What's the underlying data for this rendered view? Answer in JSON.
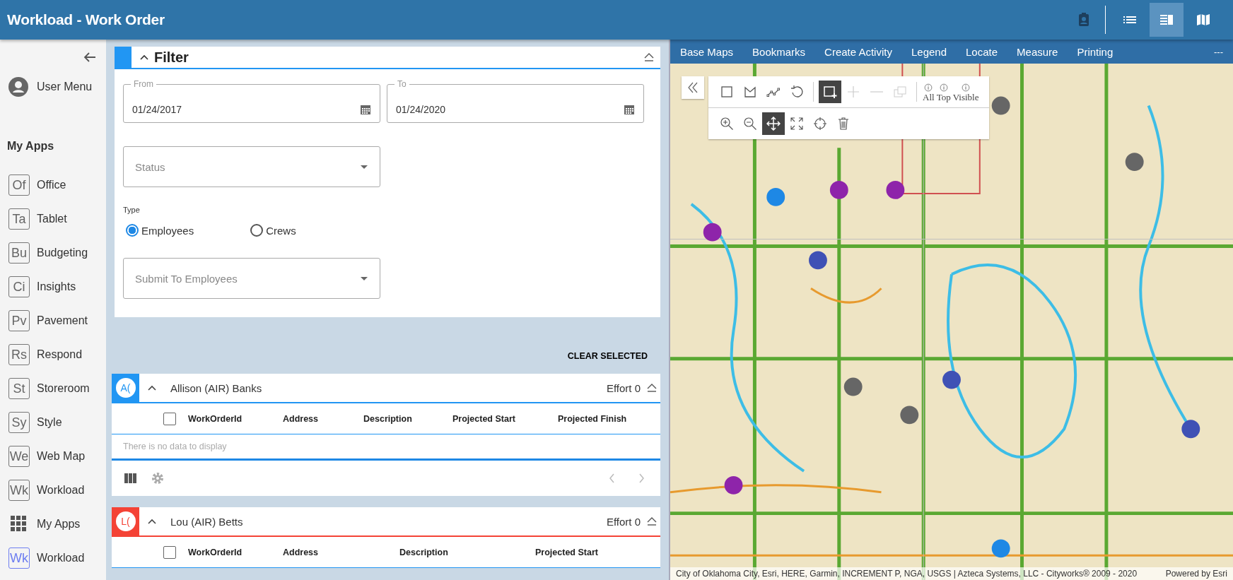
{
  "header": {
    "title": "Workload - Work Order",
    "buttons": [
      {
        "kind": "badge",
        "selected": false
      },
      {
        "kind": "list",
        "selected": false
      },
      {
        "kind": "split",
        "selected": true
      },
      {
        "kind": "map",
        "selected": false
      }
    ]
  },
  "sidebar": {
    "user_menu": "User Menu",
    "section": "My Apps",
    "apps": [
      {
        "kind": "app",
        "abbr": "Of",
        "label": "Office",
        "selected": false
      },
      {
        "kind": "app",
        "abbr": "Ta",
        "label": "Tablet",
        "selected": false
      },
      {
        "kind": "app",
        "abbr": "Bu",
        "label": "Budgeting",
        "selected": false
      },
      {
        "kind": "app",
        "abbr": "Ci",
        "label": "Insights",
        "selected": false
      },
      {
        "kind": "app",
        "abbr": "Pv",
        "label": "Pavement",
        "selected": false
      },
      {
        "kind": "app",
        "abbr": "Rs",
        "label": "Respond",
        "selected": false
      },
      {
        "kind": "app",
        "abbr": "St",
        "label": "Storeroom",
        "selected": false
      },
      {
        "kind": "app",
        "abbr": "Sy",
        "label": "Style",
        "selected": false
      },
      {
        "kind": "app",
        "abbr": "We",
        "label": "Web Map",
        "selected": false
      },
      {
        "kind": "app",
        "abbr": "Wk",
        "label": "Workload",
        "selected": false
      },
      {
        "kind": "grid",
        "label": "My Apps",
        "selected": false
      },
      {
        "kind": "app",
        "abbr": "Wk",
        "label": "Workload",
        "selected": true
      }
    ]
  },
  "filter": {
    "title": "Filter",
    "from": {
      "label": "From",
      "value": "01/24/2017"
    },
    "to": {
      "label": "To",
      "value": "01/24/2020"
    },
    "status": {
      "placeholder": "Status"
    },
    "type": {
      "label": "Type",
      "options": [
        {
          "label": "Employees",
          "selected": true
        },
        {
          "label": "Crews",
          "selected": false
        }
      ]
    },
    "submit_to": {
      "placeholder": "Submit To Employees"
    }
  },
  "clear_selected": "CLEAR SELECTED",
  "employees": [
    {
      "initials": "A(",
      "name": "Allison (AIR) Banks",
      "color": "#2196f3",
      "effort": "Effort 0",
      "columns": [
        "WorkOrderId",
        "Address",
        "Description",
        "Projected Start",
        "Projected Finish"
      ],
      "all_checked": false,
      "empty_text": "There is no data to display",
      "footer": true
    },
    {
      "initials": "L(",
      "name": "Lou (AIR) Betts",
      "color": "#f44336",
      "effort": "Effort 0",
      "columns": [
        "WorkOrderId",
        "Address",
        "Description",
        "Projected Start"
      ],
      "all_checked": false
    }
  ],
  "map": {
    "menu": [
      "Base Maps",
      "Bookmarks",
      "Create Activity",
      "Legend",
      "Locate",
      "Measure",
      "Printing"
    ],
    "more": "---",
    "toolbar": [
      [
        {
          "kind": "rect",
          "active": false,
          "disabled": false
        },
        {
          "kind": "polygon",
          "active": false,
          "disabled": false
        },
        {
          "kind": "polyline",
          "active": false,
          "disabled": false
        },
        {
          "kind": "undo",
          "active": false,
          "disabled": false
        },
        {
          "kind": "sep"
        },
        {
          "kind": "addrect",
          "active": true,
          "disabled": false
        },
        {
          "kind": "plus",
          "active": false,
          "disabled": true
        },
        {
          "kind": "minus",
          "active": false,
          "disabled": true
        },
        {
          "kind": "copy",
          "active": false,
          "disabled": true
        },
        {
          "kind": "sep"
        },
        {
          "kind": "info",
          "label": "All",
          "active": false,
          "disabled": false
        },
        {
          "kind": "info",
          "label": "Top",
          "active": false,
          "disabled": false
        },
        {
          "kind": "info",
          "label": "Visible",
          "active": false,
          "disabled": false
        }
      ],
      [
        {
          "kind": "zoomin",
          "active": false,
          "disabled": false
        },
        {
          "kind": "zoomout",
          "active": false,
          "disabled": false
        },
        {
          "kind": "pan",
          "active": true,
          "disabled": false
        },
        {
          "kind": "extent",
          "active": false,
          "disabled": false
        },
        {
          "kind": "crosshair",
          "active": false,
          "disabled": false
        },
        {
          "kind": "trash",
          "active": false,
          "disabled": false
        }
      ]
    ],
    "attribution": "City of Oklahoma City, Esri, HERE, Garmin, INCREMENT P, NGA, USGS | Azteca Systems, LLC - Cityworks® 2009 - 2020",
    "powered": "Powered by Esri"
  }
}
